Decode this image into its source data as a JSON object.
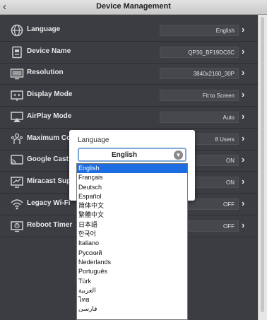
{
  "header": {
    "title": "Device Management",
    "back_icon": "back-arrow-icon"
  },
  "settings": [
    {
      "label": "Language",
      "value": "English",
      "icon": "globe-icon"
    },
    {
      "label": "Device Name",
      "value": "QP30_BF19DC6C",
      "icon": "device-id-icon"
    },
    {
      "label": "Resolution",
      "value": "3840x2160_30P",
      "icon": "monitor-icon"
    },
    {
      "label": "Display Mode",
      "value": "Fit to Screen",
      "icon": "fit-screen-icon"
    },
    {
      "label": "AirPlay Mode",
      "value": "Auto",
      "icon": "airplay-icon"
    },
    {
      "label": "Maximum Co",
      "value": "8 Users",
      "icon": "users-icon"
    },
    {
      "label": "Google Cast S",
      "value": "ON",
      "icon": "cast-icon"
    },
    {
      "label": "Miracast Supp",
      "value": "ON",
      "icon": "miracast-icon"
    },
    {
      "label": "Legacy Wi-Fi",
      "value": "OFF",
      "icon": "wifi-icon"
    },
    {
      "label": "Reboot Timer",
      "value": "OFF",
      "icon": "timer-icon"
    }
  ],
  "popup": {
    "title": "Language",
    "selected": "English",
    "options": [
      "English",
      "Français",
      "Deutsch",
      "Español",
      "简体中文",
      "繁體中文",
      "日本語",
      "한국어",
      "Italiano",
      "Русский",
      "Nederlands",
      "Português",
      "Türk",
      "العربية",
      "ไทย",
      "فارسی"
    ]
  }
}
